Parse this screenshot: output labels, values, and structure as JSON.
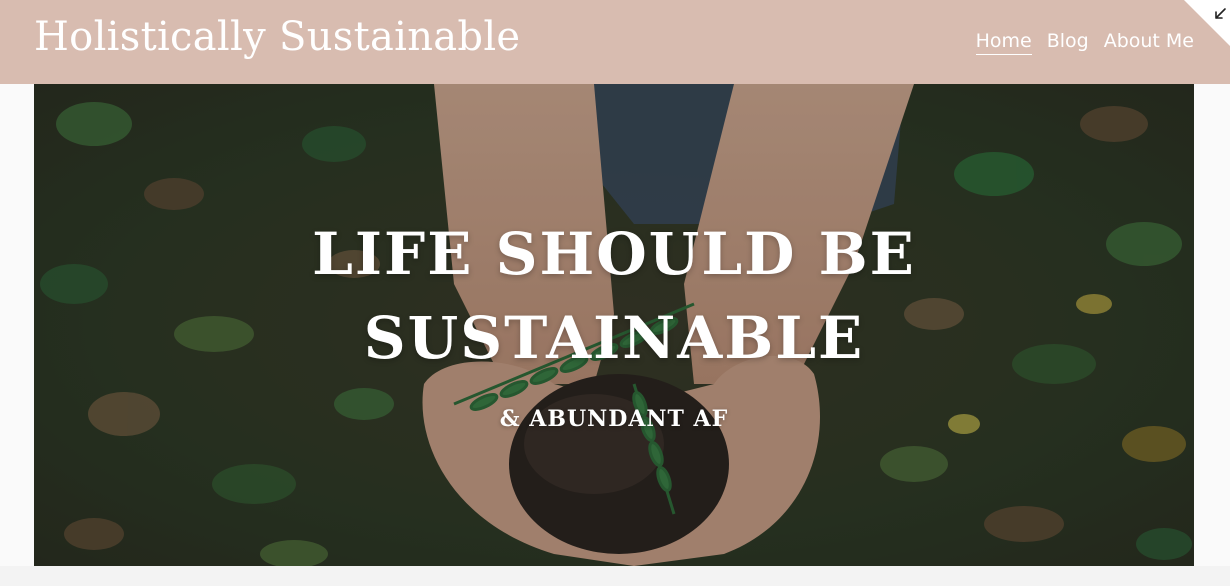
{
  "site": {
    "title": "Holistically Sustainable"
  },
  "nav": {
    "items": [
      {
        "label": "Home",
        "active": true
      },
      {
        "label": "Blog",
        "active": false
      },
      {
        "label": "About Me",
        "active": false
      }
    ]
  },
  "corner": {
    "icon": "collapse-arrow-icon"
  },
  "hero": {
    "heading_line1": "LIFE SHOULD BE",
    "heading_line2": "SUSTAINABLE",
    "subheading": "& ABUNDANT AF",
    "image": "hands-holding-soil-and-fern-photo"
  },
  "colors": {
    "header_bg": "#d8bcb0",
    "text_on_header": "#ffffff",
    "hero_text": "#ffffff"
  }
}
